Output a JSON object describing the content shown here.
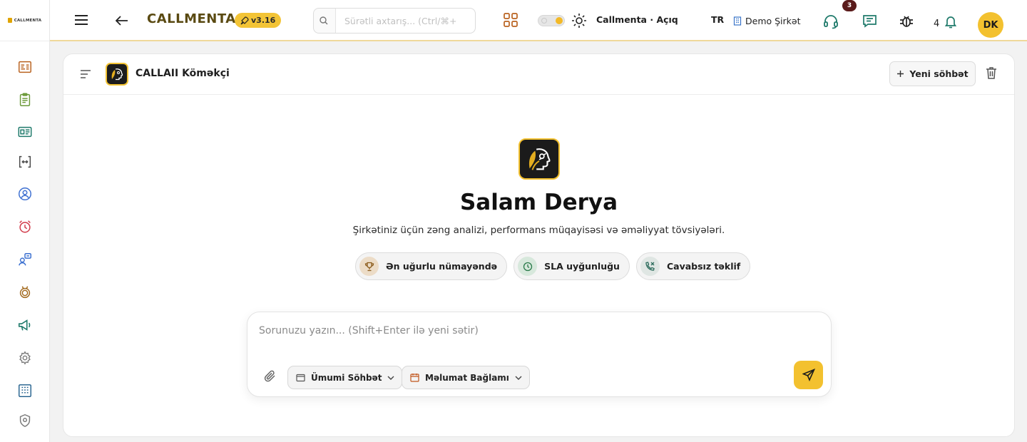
{
  "brand": {
    "name": "CALLMENTA"
  },
  "sidebar": {
    "items": [
      {
        "name": "dashboard",
        "icon": "report-icon"
      },
      {
        "name": "clipboard",
        "icon": "clipboard-icon"
      },
      {
        "name": "cards",
        "icon": "id-card-icon"
      },
      {
        "name": "integration",
        "icon": "code-brackets-icon"
      },
      {
        "name": "user-circle",
        "icon": "user-circle-icon"
      },
      {
        "name": "alarm",
        "icon": "alarm-clock-icon"
      },
      {
        "name": "user-chat",
        "icon": "user-chat-icon"
      },
      {
        "name": "medal",
        "icon": "medal-icon"
      },
      {
        "name": "announcement",
        "icon": "megaphone-icon"
      },
      {
        "name": "settings",
        "icon": "gear-icon"
      },
      {
        "name": "grid",
        "icon": "grid-icon"
      },
      {
        "name": "security",
        "icon": "shield-icon"
      }
    ]
  },
  "header": {
    "app_title": "CALLMENTA",
    "version": "v3.16",
    "search_placeholder": "Sürətli axtarış... (Ctrl/⌘+",
    "workspace_label": "Callmenta · Açıq",
    "language": "TR",
    "company": "Demo Şirkət",
    "messages_badge": "3",
    "notification_count": "4",
    "avatar_initials": "DK"
  },
  "panel": {
    "title": "CALLAII Köməkçi",
    "new_chat_label": "Yeni söhbət"
  },
  "hero": {
    "greeting": "Salam Derya",
    "subtitle": "Şirkətiniz üçün zəng analizi, performans müqayisəsi və əməliyyat tövsiyələri."
  },
  "suggestions": [
    {
      "label": "Ən uğurlu nümayəndə",
      "icon": "trophy-icon"
    },
    {
      "label": "SLA uyğunluğu",
      "icon": "clock-icon"
    },
    {
      "label": "Cavabsız təklif",
      "icon": "phone-missed-icon"
    }
  ],
  "composer": {
    "placeholder": "Sorunuzu yazın... (Shift+Enter ilə yeni sətir)",
    "mode_label": "Ümumi Söhbət",
    "context_label": "Məlumat Bağlamı"
  },
  "colors": {
    "accent": "#f3c12f",
    "title_brown": "#5a4a12",
    "badge_dark": "#5a1b1b"
  }
}
